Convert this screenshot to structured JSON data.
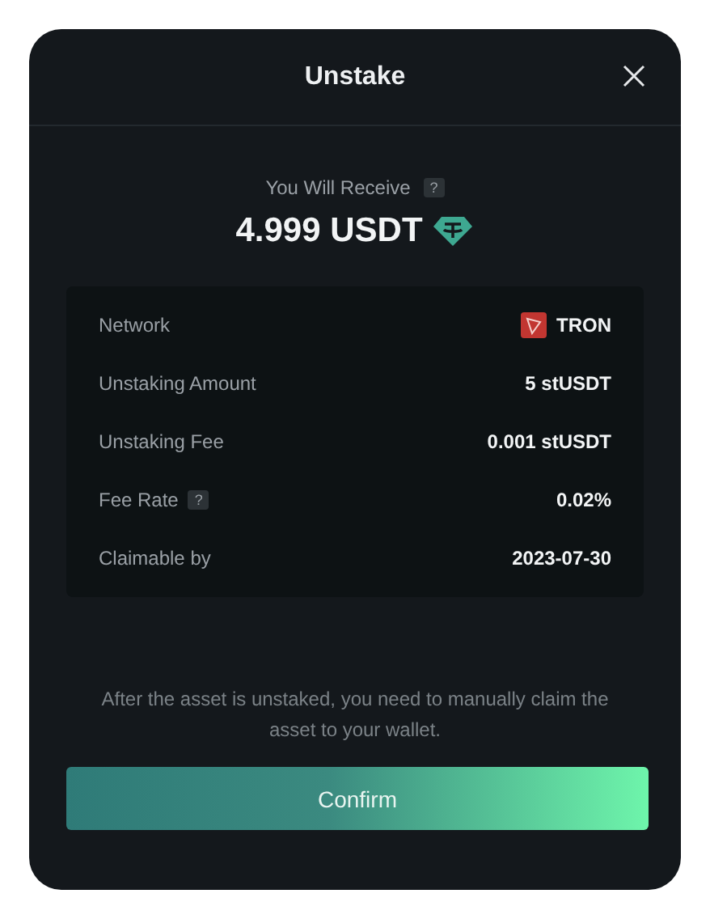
{
  "dialog": {
    "title": "Unstake"
  },
  "receive": {
    "label": "You Will Receive",
    "help": "?",
    "amount": "4.999 USDT"
  },
  "details": [
    {
      "kind": "network",
      "label": "Network",
      "value": "TRON"
    },
    {
      "kind": "plain",
      "label": "Unstaking Amount",
      "value": "5 stUSDT"
    },
    {
      "kind": "plain",
      "label": "Unstaking Fee",
      "value": "0.001 stUSDT"
    },
    {
      "kind": "plain",
      "label": "Fee Rate",
      "help": "?",
      "value": "0.02%"
    },
    {
      "kind": "plain",
      "label": "Claimable by",
      "value": "2023-07-30"
    }
  ],
  "note": "After the asset is unstaked, you need to manually claim the asset to your wallet.",
  "confirm_button": "Confirm"
}
